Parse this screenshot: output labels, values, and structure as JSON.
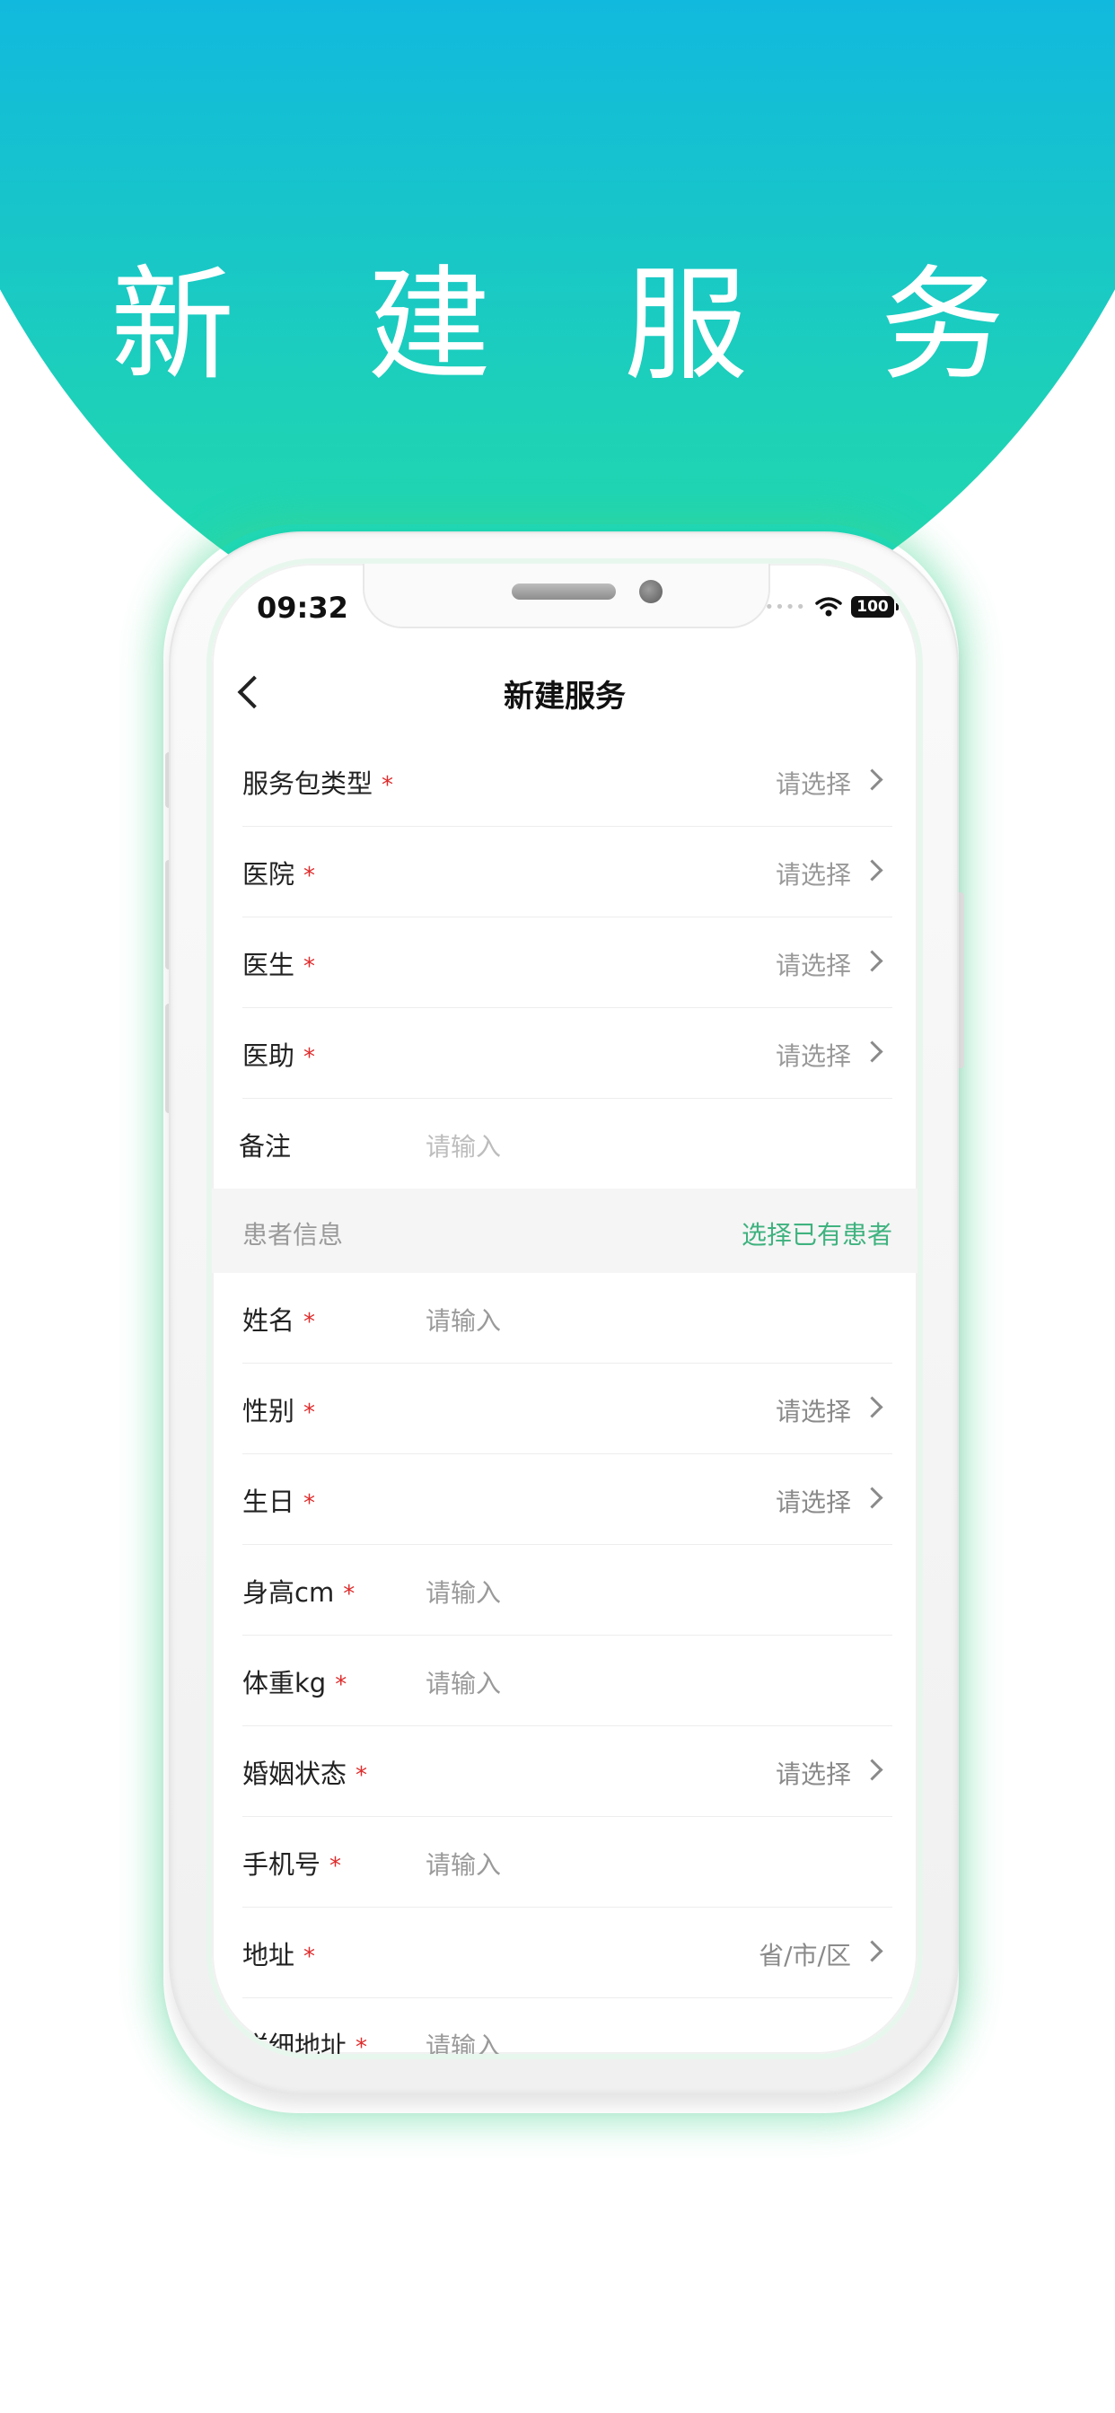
{
  "hero": {
    "title": "新 建 服 务"
  },
  "status_bar": {
    "time": "09:32",
    "battery": "100"
  },
  "nav": {
    "title": "新建服务"
  },
  "service_rows": [
    {
      "label": "服务包类型",
      "required": true,
      "type": "select",
      "value": "请选择"
    },
    {
      "label": "医院",
      "required": true,
      "type": "select",
      "value": "请选择"
    },
    {
      "label": "医生",
      "required": true,
      "type": "select",
      "value": "请选择"
    },
    {
      "label": "医助",
      "required": true,
      "type": "select",
      "value": "请选择"
    },
    {
      "label": "备注",
      "required": false,
      "type": "input",
      "placeholder": "请输入"
    }
  ],
  "patient_section": {
    "title": "患者信息",
    "action": "选择已有患者"
  },
  "patient_rows": [
    {
      "label": "姓名",
      "required": true,
      "type": "input",
      "placeholder": "请输入"
    },
    {
      "label": "性别",
      "required": true,
      "type": "select",
      "value": "请选择"
    },
    {
      "label": "生日",
      "required": true,
      "type": "select",
      "value": "请选择"
    },
    {
      "label": "身高cm",
      "required": true,
      "type": "input",
      "placeholder": "请输入"
    },
    {
      "label": "体重kg",
      "required": true,
      "type": "input",
      "placeholder": "请输入"
    },
    {
      "label": "婚姻状态",
      "required": true,
      "type": "select",
      "value": "请选择"
    },
    {
      "label": "手机号",
      "required": true,
      "type": "input",
      "placeholder": "请输入"
    },
    {
      "label": "地址",
      "required": true,
      "type": "select",
      "value": "省/市/区"
    },
    {
      "label": "详细地址",
      "required": true,
      "type": "input",
      "placeholder": "请输入"
    }
  ],
  "required_mark": "*",
  "colors": {
    "accent_green": "#3fb27f",
    "gradient_top": "#10b6e2",
    "gradient_bottom": "#22dcb0",
    "required_red": "#e02b2b"
  },
  "icons": {
    "back": "chevron-left-icon",
    "row_arrow": "chevron-right-icon",
    "wifi": "wifi-icon",
    "battery": "battery-icon"
  }
}
